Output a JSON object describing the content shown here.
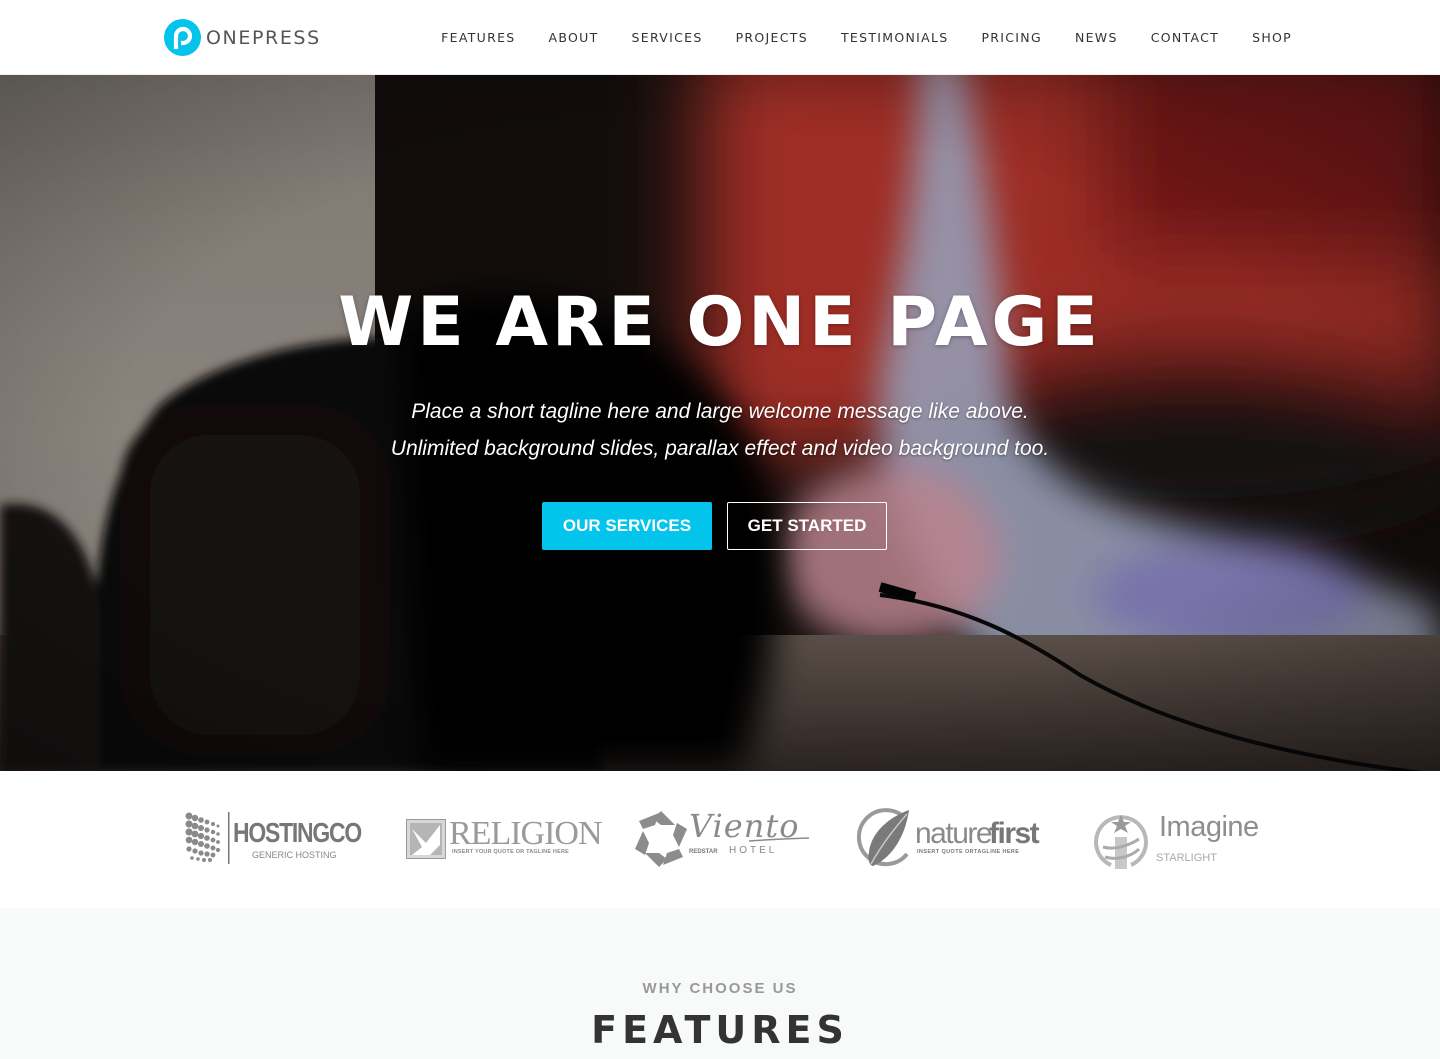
{
  "header": {
    "logo_text": "ONEPRESS",
    "logo_icon": "onepress-p-icon",
    "nav": [
      {
        "label": "FEATURES"
      },
      {
        "label": "ABOUT"
      },
      {
        "label": "SERVICES"
      },
      {
        "label": "PROJECTS"
      },
      {
        "label": "TESTIMONIALS"
      },
      {
        "label": "PRICING"
      },
      {
        "label": "NEWS"
      },
      {
        "label": "CONTACT"
      },
      {
        "label": "SHOP"
      }
    ]
  },
  "hero": {
    "title": "WE ARE ONE PAGE",
    "tagline_line1": "Place a short tagline here and large welcome message like above.",
    "tagline_line2": "Unlimited background slides, parallax effect and video background too.",
    "primary_button": "OUR SERVICES",
    "secondary_button": "GET STARTED"
  },
  "clients": [
    {
      "name": "HOSTINGCO",
      "tagline": "GENERIC HOSTING"
    },
    {
      "name": "RELIGION",
      "tagline": "INSERT YOUR QUOTE OR TAGLINE HERE"
    },
    {
      "name": "Viento",
      "sub_left": "REDSTAR",
      "sub_right": "HOTEL"
    },
    {
      "name_a": "nature",
      "name_b": "first",
      "tagline": "INSERT QUOTE ORTAGLINE HERE"
    },
    {
      "name": "Imagine",
      "tagline": "STARLIGHT"
    }
  ],
  "features": {
    "subtitle": "WHY CHOOSE US",
    "title": "FEATURES"
  },
  "colors": {
    "accent": "#03c4eb",
    "nav_text": "#333333",
    "logo_gray": "#555555",
    "features_bg": "#f8f9f9"
  }
}
